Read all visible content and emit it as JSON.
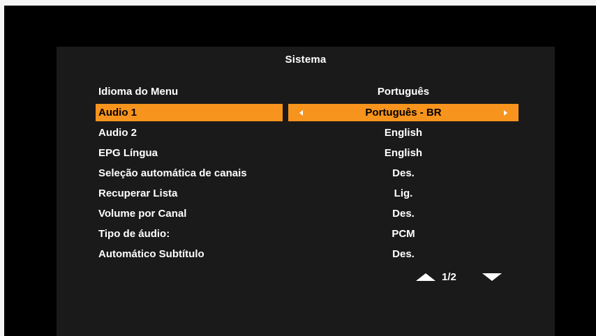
{
  "menu": {
    "title": "Sistema",
    "items": [
      {
        "label": "Idioma do Menu",
        "value": "Português"
      },
      {
        "label": "Audio 1",
        "value": "Português - BR"
      },
      {
        "label": "Audio 2",
        "value": "English"
      },
      {
        "label": "EPG Língua",
        "value": "English"
      },
      {
        "label": "Seleção automática de canais",
        "value": "Des."
      },
      {
        "label": "Recuperar Lista",
        "value": "Lig."
      },
      {
        "label": "Volume por Canal",
        "value": "Des."
      },
      {
        "label": "Tipo de áudio:",
        "value": "PCM"
      },
      {
        "label": "Automático Subtítulo",
        "value": "Des."
      }
    ],
    "selected_index": 1
  },
  "pagination": {
    "text": "1/2",
    "prev_icon": "triangle-up-icon",
    "next_icon": "triangle-down-icon"
  },
  "colors": {
    "highlight": "#f7941d",
    "panel_bg": "#1a1a1a",
    "screen_bg": "#000000",
    "text": "#ffffff"
  }
}
